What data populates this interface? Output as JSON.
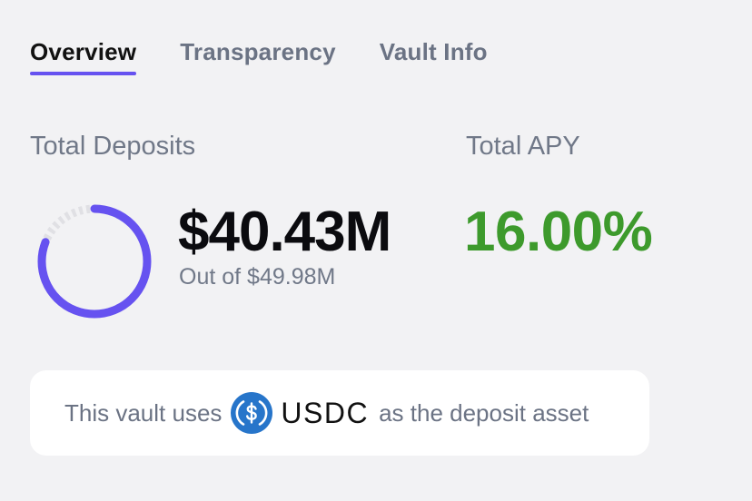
{
  "tabs": [
    {
      "label": "Overview",
      "active": true
    },
    {
      "label": "Transparency",
      "active": false
    },
    {
      "label": "Vault Info",
      "active": false
    }
  ],
  "deposits": {
    "label": "Total Deposits",
    "amount": "$40.43M",
    "cap_text": "Out of $49.98M",
    "fill_fraction": 0.809
  },
  "apy": {
    "label": "Total APY",
    "value": "16.00%"
  },
  "asset_notice": {
    "prefix": "This vault uses",
    "asset": "USDC",
    "suffix": "as the deposit asset",
    "icon": "usdc-coin-icon"
  },
  "colors": {
    "accent": "#6652f0",
    "apy_green": "#3d9a2c",
    "usdc_blue": "#2775ca",
    "ring_track": "#e0e0e4"
  }
}
